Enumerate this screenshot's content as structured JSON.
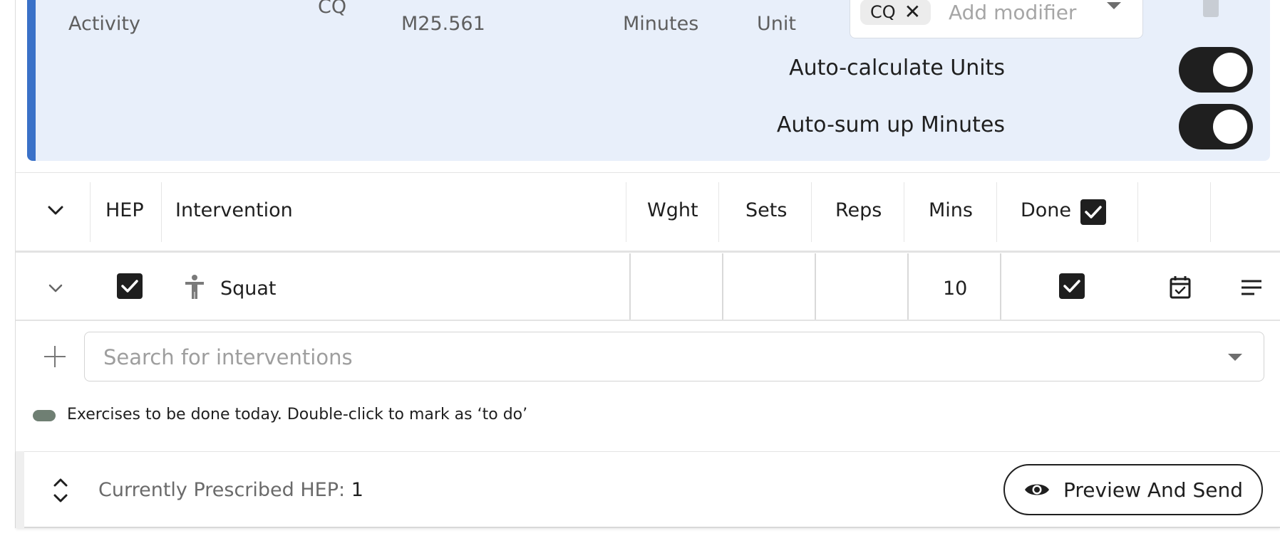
{
  "billing": {
    "row_label": "Activity",
    "code": "CQ",
    "diagnosis": "M25.561",
    "minutes_label": "Minutes",
    "unit_label": "Unit",
    "modifier_chip": "CQ",
    "modifier_placeholder": "Add modifier",
    "auto_units_label": "Auto-calculate Units",
    "auto_units_on": true,
    "auto_minutes_label": "Auto-sum up Minutes",
    "auto_minutes_on": true,
    "accent_color": "#3a71c8",
    "panel_color": "#e8effa"
  },
  "table": {
    "headers": {
      "hep": "HEP",
      "intervention": "Intervention",
      "weight": "Wght",
      "sets": "Sets",
      "reps": "Reps",
      "mins": "Mins",
      "done": "Done"
    },
    "done_all_checked": true,
    "rows": [
      {
        "hep_checked": true,
        "icon": "person-icon",
        "name": "Squat",
        "weight": "",
        "sets": "",
        "reps": "",
        "mins": "10",
        "done_checked": true,
        "actions": [
          "calendar-check-icon",
          "notes-icon"
        ]
      }
    ]
  },
  "search": {
    "placeholder": "Search for interventions"
  },
  "legend": {
    "text": "Exercises to be done today. Double-click to mark as ‘to do’",
    "color": "#6f7f73"
  },
  "footer": {
    "prescribed_label": "Currently Prescribed HEP:",
    "prescribed_count": "1",
    "preview_button": "Preview And Send"
  }
}
